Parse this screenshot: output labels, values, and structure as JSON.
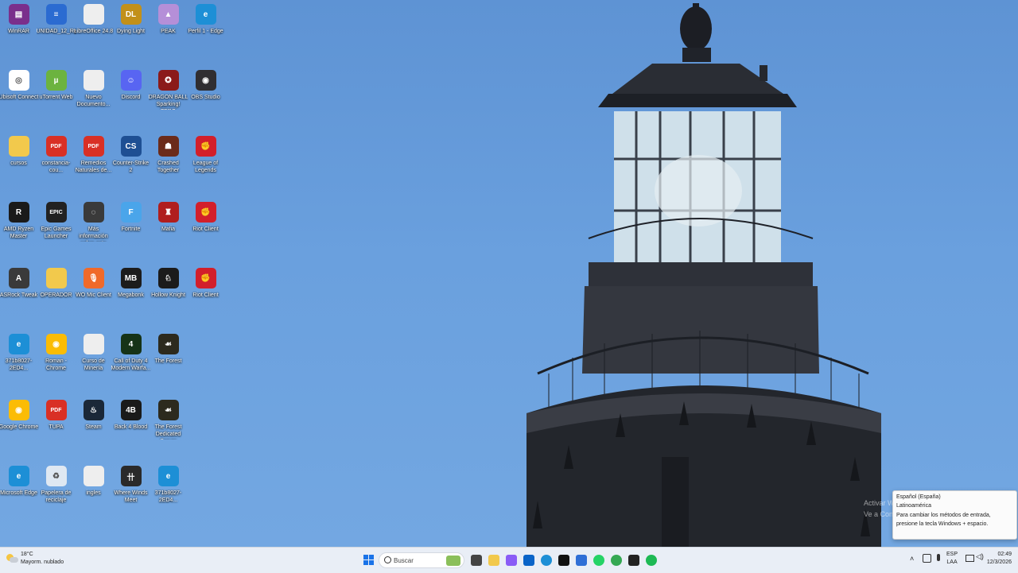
{
  "desktop": {
    "icons": [
      {
        "label": "WinRAR",
        "icon": "winrar-icon",
        "color": "#7a2f8c",
        "glyph": "▤"
      },
      {
        "label": "UNIDAD_12_Ra...",
        "icon": "word-document-icon",
        "color": "#2b6bd1",
        "glyph": "≡"
      },
      {
        "label": "LibreOffice 24.8",
        "icon": "document-icon",
        "color": "#eeeeee",
        "glyph": ""
      },
      {
        "label": "Dying Light",
        "icon": "dying-light-icon",
        "color": "#c2901a",
        "glyph": "DL"
      },
      {
        "label": "PEAK",
        "icon": "peak-game-icon",
        "color": "#b58fd8",
        "glyph": "▲"
      },
      {
        "label": "Perfil 1 - Edge",
        "icon": "edge-icon",
        "color": "#1d8fd6",
        "glyph": "e"
      },
      {
        "label": "Ubisoft Connect",
        "icon": "ubisoft-icon",
        "color": "#ffffff",
        "glyph": "◎"
      },
      {
        "label": "uTorrent Web",
        "icon": "utorrent-icon",
        "color": "#6cb33f",
        "glyph": "µ"
      },
      {
        "label": "Nuevo Documento...",
        "icon": "document-icon",
        "color": "#eeeeee",
        "glyph": ""
      },
      {
        "label": "Discord",
        "icon": "discord-icon",
        "color": "#5865f2",
        "glyph": "☺"
      },
      {
        "label": "DRAGON BALL Sparking! ZERO",
        "icon": "dragon-ball-icon",
        "color": "#8b1a1a",
        "glyph": "✪"
      },
      {
        "label": "OBS Studio",
        "icon": "obs-icon",
        "color": "#302e31",
        "glyph": "◉"
      },
      {
        "label": "cursos",
        "icon": "folder-icon",
        "color": "#f2c94c",
        "glyph": ""
      },
      {
        "label": "constancia-cou...",
        "icon": "pdf-icon",
        "color": "#d93025",
        "glyph": "PDF"
      },
      {
        "label": "Remedios Naturales de...",
        "icon": "pdf-icon",
        "color": "#d93025",
        "glyph": "PDF"
      },
      {
        "label": "Counter-Strike 2",
        "icon": "counter-strike-icon",
        "color": "#1e4f93",
        "glyph": "CS"
      },
      {
        "label": "Crashed Together",
        "icon": "crashed-together-icon",
        "color": "#6b2b1a",
        "glyph": "☗"
      },
      {
        "label": "League of Legends",
        "icon": "riot-client-icon",
        "color": "#d21f2b",
        "glyph": "✊"
      },
      {
        "label": "AMD Ryzen Master",
        "icon": "amd-ryzen-icon",
        "color": "#1a1a1a",
        "glyph": "R"
      },
      {
        "label": "Epic Games Launcher",
        "icon": "epic-games-icon",
        "color": "#222222",
        "glyph": "EPIC"
      },
      {
        "label": "Más información sobre esta ima...",
        "icon": "info-camera-icon",
        "color": "#3a3a3a",
        "glyph": "◌"
      },
      {
        "label": "Fortnite",
        "icon": "fortnite-icon",
        "color": "#4aa5ea",
        "glyph": "F"
      },
      {
        "label": "Mafia",
        "icon": "mafia-icon",
        "color": "#b01e1e",
        "glyph": "♜"
      },
      {
        "label": "Riot Client",
        "icon": "riot-client-icon",
        "color": "#d21f2b",
        "glyph": "✊"
      },
      {
        "label": "ASRock Tweak",
        "icon": "asrock-icon",
        "color": "#3a3a3a",
        "glyph": "A"
      },
      {
        "label": "OPERADOR",
        "icon": "folder-icon",
        "color": "#f2c94c",
        "glyph": ""
      },
      {
        "label": "WO Mic Client",
        "icon": "microphone-icon",
        "color": "#f06a2a",
        "glyph": "🎙"
      },
      {
        "label": "Megabonk",
        "icon": "megabonk-icon",
        "color": "#1c1c1c",
        "glyph": "MB"
      },
      {
        "label": "Hollow Knight",
        "icon": "hollow-knight-icon",
        "color": "#1b1b1b",
        "glyph": "♘"
      },
      {
        "label": "Riot Client",
        "icon": "riot-client-icon",
        "color": "#d21f2b",
        "glyph": "✊"
      },
      {
        "label": "371b8027-2ED4...",
        "icon": "edge-icon",
        "color": "#1d8fd6",
        "glyph": "e"
      },
      {
        "label": "Roman - Chrome",
        "icon": "chrome-icon",
        "color": "#fbbc05",
        "glyph": "◉"
      },
      {
        "label": "Curso de Minería",
        "icon": "document-icon",
        "color": "#eeeeee",
        "glyph": ""
      },
      {
        "label": "Call of Duty 4 Modern Warfa...",
        "icon": "call-of-duty-icon",
        "color": "#163317",
        "glyph": "4"
      },
      {
        "label": "The Forest",
        "icon": "the-forest-icon",
        "color": "#2c2a1e",
        "glyph": "☙"
      },
      {
        "label": "",
        "icon": "",
        "color": "",
        "glyph": ""
      },
      {
        "label": "Google Chrome",
        "icon": "chrome-icon",
        "color": "#fbbc05",
        "glyph": "◉"
      },
      {
        "label": "TUPA",
        "icon": "pdf-icon",
        "color": "#d93025",
        "glyph": "PDF"
      },
      {
        "label": "Steam",
        "icon": "steam-icon",
        "color": "#1b2838",
        "glyph": "♨"
      },
      {
        "label": "Back 4 Blood",
        "icon": "back-4-blood-icon",
        "color": "#1a1a1a",
        "glyph": "4B"
      },
      {
        "label": "The Forest Dedicated Server",
        "icon": "the-forest-icon",
        "color": "#2c2a1e",
        "glyph": "☙"
      },
      {
        "label": "",
        "icon": "",
        "color": "",
        "glyph": ""
      },
      {
        "label": "Microsoft Edge",
        "icon": "edge-icon",
        "color": "#1d8fd6",
        "glyph": "e"
      },
      {
        "label": "Papelera de reciclaje",
        "icon": "recycle-bin-icon",
        "color": "#dfe8f2",
        "glyph": "♻"
      },
      {
        "label": "ingles",
        "icon": "document-icon",
        "color": "#eeeeee",
        "glyph": ""
      },
      {
        "label": "Where Winds Meet",
        "icon": "where-winds-meet-icon",
        "color": "#2a2a2a",
        "glyph": "卄"
      },
      {
        "label": "371b8027-2ED4...",
        "icon": "edge-icon",
        "color": "#1d8fd6",
        "glyph": "e"
      },
      {
        "label": "",
        "icon": "",
        "color": "",
        "glyph": ""
      }
    ]
  },
  "watermark": {
    "line1": "Activar Windows",
    "line2": "Ve a Configuración para activar Windows."
  },
  "toast": {
    "title": "Español (España)",
    "subtitle": "Latinoamérica",
    "body": "Para cambiar los métodos de entrada, presione la tecla Windows + espacio."
  },
  "taskbar": {
    "weather": {
      "temp": "18°C",
      "condition": "Mayorm. nublado"
    },
    "search_placeholder": "Buscar",
    "apps": [
      {
        "name": "task-view",
        "color": "#444444"
      },
      {
        "name": "file-explorer",
        "color": "#f2c94c"
      },
      {
        "name": "copilot",
        "color": "#8a5cf6"
      },
      {
        "name": "outlook",
        "color": "#0a64c8"
      },
      {
        "name": "edge",
        "color": "#1d8fd6"
      },
      {
        "name": "capcut",
        "color": "#111111"
      },
      {
        "name": "microsoft-store",
        "color": "#2f6fd6"
      },
      {
        "name": "whatsapp",
        "color": "#25d366"
      },
      {
        "name": "chrome",
        "color": "#34a853"
      },
      {
        "name": "chatgpt",
        "color": "#222222"
      },
      {
        "name": "spotify",
        "color": "#1db954"
      }
    ],
    "language": {
      "line1": "ESP",
      "line2": "LAA"
    },
    "clock": {
      "time": "02:49",
      "date": "12/3/2026"
    }
  }
}
